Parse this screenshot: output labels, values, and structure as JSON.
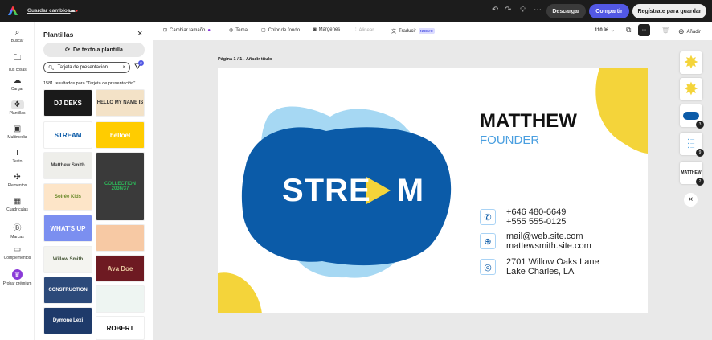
{
  "topbar": {
    "save": "Guardar cambios",
    "download": "Descargar",
    "share": "Compartir",
    "register": "Regístrate para guardar"
  },
  "rail": [
    {
      "label": "Buscar",
      "icon": "search-icon"
    },
    {
      "label": "Tus cosas",
      "icon": "folder-icon"
    },
    {
      "label": "Cargar",
      "icon": "upload-icon"
    },
    {
      "label": "Plantillas",
      "icon": "templates-icon"
    },
    {
      "label": "Multimedia",
      "icon": "media-icon"
    },
    {
      "label": "Texto",
      "icon": "text-icon"
    },
    {
      "label": "Elementos",
      "icon": "elements-icon"
    },
    {
      "label": "Cuadrículas",
      "icon": "grid-icon"
    },
    {
      "label": "Marcas",
      "icon": "brand-icon"
    },
    {
      "label": "Complementos",
      "icon": "addons-icon"
    },
    {
      "label": "Probar prémium",
      "icon": "crown-icon"
    }
  ],
  "panel": {
    "title": "Plantillas",
    "text_to_template": "De texto a plantilla",
    "search_value": "Tarjeta de presentación",
    "filter_count": "2",
    "results": "1581 resultados para \"Tarjeta de presentación\""
  },
  "thumbs": [
    {
      "text": "DJ DEKS",
      "bg": "#1a1a1a",
      "fg": "#fff"
    },
    {
      "text": "HELLO MY NAME IS",
      "bg": "#f3e2c7",
      "fg": "#333"
    },
    {
      "text": "STREAM",
      "bg": "#fff",
      "fg": "#0b5ba8"
    },
    {
      "text": "helloel",
      "bg": "#ffcc00",
      "fg": "#fff"
    },
    {
      "text": "Matthew Smith",
      "bg": "#eeeeea",
      "fg": "#444"
    },
    {
      "text": "COLLECTION 2036/37",
      "bg": "#3a3a3a",
      "fg": "#2dbb5a"
    },
    {
      "text": "Soirée Kids",
      "bg": "#fde5c8",
      "fg": "#6a8a2a"
    },
    {
      "text": "",
      "bg": "#f7c9a4",
      "fg": "#7a4a2a"
    },
    {
      "text": "WHAT'S UP",
      "bg": "#7b8ff0",
      "fg": "#fff"
    },
    {
      "text": "Ava Doe",
      "bg": "#6e1a22",
      "fg": "#e8c9a0"
    },
    {
      "text": "Willow Smith",
      "bg": "#f4f4f0",
      "fg": "#4a5a3a"
    },
    {
      "text": "",
      "bg": "#eef5f2",
      "fg": "#7aa"
    },
    {
      "text": "CONSTRUCTION",
      "bg": "#2c4a7a",
      "fg": "#fff"
    },
    {
      "text": "ROBERT",
      "bg": "#fff",
      "fg": "#111"
    },
    {
      "text": "Dymone Lexi",
      "bg": "#1e3a6a",
      "fg": "#fff"
    }
  ],
  "toolbar": {
    "resize": "Cambiar tamaño",
    "theme": "Tema",
    "bg_color": "Color de fondo",
    "margins": "Márgenes",
    "align": "Alinear",
    "translate": "Traducir",
    "new_badge": "NUEVO",
    "zoom": "110 %",
    "add": "Añadir"
  },
  "page": {
    "label": "Página 1 / 1 - Añadir título"
  },
  "card": {
    "logo": "STRE",
    "logo_end": "M",
    "name": "MATTHEW",
    "role": "FOUNDER",
    "phone1": "+646 480-6649",
    "phone2": "+555 555-0125",
    "email": "mail@web.site.com",
    "web": "mattewsmith.site.com",
    "addr1": "2701 Willow Oaks Lane",
    "addr2": "Lake Charles, LA",
    "colors": {
      "blue": "#0b5ba8",
      "light_blue": "#a6d8f3",
      "yellow": "#f4d43a",
      "accent": "#4a9fe0"
    }
  },
  "side": {
    "badges": [
      "3",
      "9",
      "2"
    ],
    "thumb_text": "MATTHEW"
  }
}
